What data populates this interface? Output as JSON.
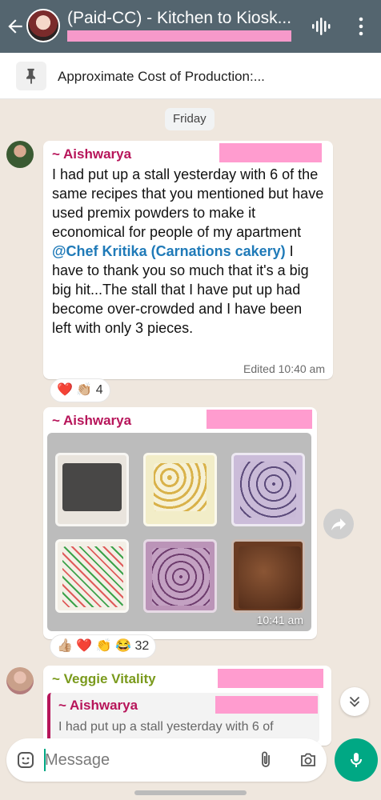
{
  "header": {
    "title": "(Paid-CC) - Kitchen to Kiosk..."
  },
  "pinned": {
    "text": "Approximate Cost of Production:..."
  },
  "day_separator": "Friday",
  "messages": [
    {
      "sender": "~ Aishwarya",
      "sender_color": "#b7155a",
      "text_before": "I had put up a stall yesterday with 6 of the same recipes that you mentioned but have used premix powders to make it economical for people of my apartment",
      "mention": "@Chef Kritika (Carnations cakery)",
      "text_after": " I have to thank you so much that it's a big big hit...The stall that I have put up had become over-crowded and I have been left with only 3 pieces.",
      "time": "Edited 10:40 am",
      "reactions": "❤️ 👏🏼 4"
    },
    {
      "sender": "~ Aishwarya",
      "sender_color": "#b7155a",
      "time": "10:41 am",
      "reactions": "👍🏼 ❤️ 👏 😂 32"
    },
    {
      "sender": "~ Veggie Vitality",
      "sender_color": "#7a9a1c",
      "quote_sender": "~ Aishwarya",
      "quote_text": "I had put up a stall yesterday with 6 of"
    }
  ],
  "composer": {
    "placeholder": "Message"
  },
  "colors": {
    "header_bg": "#54656f",
    "chat_bg": "#efe7de",
    "accent": "#00a884",
    "redaction": "#ff9ccf"
  },
  "icons": [
    "back-arrow-icon",
    "voice-call-icon",
    "more-vert-icon",
    "pin-icon",
    "forward-icon",
    "chevron-down-icon",
    "sticker-icon",
    "attach-icon",
    "camera-icon",
    "mic-icon"
  ]
}
